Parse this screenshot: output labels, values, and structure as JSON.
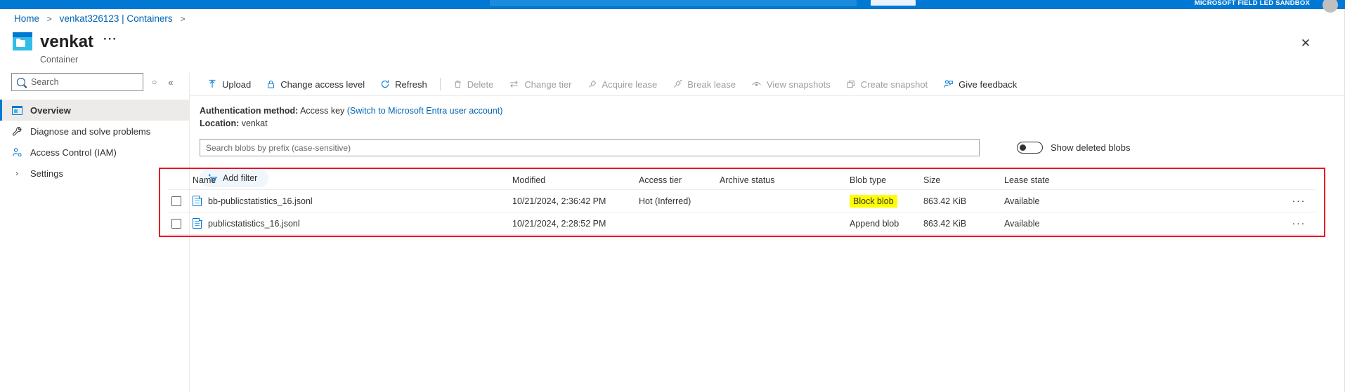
{
  "topbar": {
    "tenant_label": "MICROSOFT FIELD LED SANDBOX",
    "search_placeholder": "",
    "accent_color": "#0078d4"
  },
  "breadcrumb": {
    "items": [
      {
        "label": "Home"
      },
      {
        "label": "venkat326123 | Containers"
      }
    ],
    "separator": ">"
  },
  "header": {
    "title": "venkat",
    "subtitle": "Container",
    "ellipsis": "···",
    "close_label": "✕"
  },
  "sidebar": {
    "search_placeholder": "Search",
    "refresh_glyph": "○",
    "collapse_glyph": "«",
    "items": [
      {
        "label": "Overview",
        "icon": "overview-icon",
        "selected": true
      },
      {
        "label": "Diagnose and solve problems",
        "icon": "wrench-icon",
        "selected": false
      },
      {
        "label": "Access Control (IAM)",
        "icon": "person-key-icon",
        "selected": false
      },
      {
        "label": "Settings",
        "icon": "chevron-right-icon",
        "selected": false
      }
    ]
  },
  "toolbar": {
    "commands": [
      {
        "label": "Upload",
        "icon": "upload-icon",
        "disabled": false
      },
      {
        "label": "Change access level",
        "icon": "lock-icon",
        "disabled": false
      },
      {
        "label": "Refresh",
        "icon": "refresh-icon",
        "disabled": false
      },
      {
        "separator": true
      },
      {
        "label": "Delete",
        "icon": "trash-icon",
        "disabled": true
      },
      {
        "label": "Change tier",
        "icon": "swap-icon",
        "disabled": true
      },
      {
        "label": "Acquire lease",
        "icon": "plug-icon",
        "disabled": true
      },
      {
        "label": "Break lease",
        "icon": "unplug-icon",
        "disabled": true
      },
      {
        "label": "View snapshots",
        "icon": "eye-icon",
        "disabled": true
      },
      {
        "label": "Create snapshot",
        "icon": "copy-icon",
        "disabled": true
      },
      {
        "label": "Give feedback",
        "icon": "feedback-icon",
        "disabled": false
      }
    ]
  },
  "info": {
    "auth_label": "Authentication method:",
    "auth_value": "Access key",
    "auth_link": "(Switch to Microsoft Entra user account)",
    "location_label": "Location:",
    "location_value": "venkat"
  },
  "filters": {
    "prefix_search_placeholder": "Search blobs by prefix (case-sensitive)",
    "prefix_search_value": "",
    "show_deleted_label": "Show deleted blobs",
    "show_deleted_on": false,
    "add_filter_label": "Add filter"
  },
  "table": {
    "highlight_border_color": "#e81123",
    "columns": [
      "Name",
      "Modified",
      "Access tier",
      "Archive status",
      "Blob type",
      "Size",
      "Lease state"
    ],
    "rows": [
      {
        "checked": false,
        "name": "bb-publicstatistics_16.jsonl",
        "modified": "10/21/2024, 2:36:42 PM",
        "access_tier": "Hot (Inferred)",
        "archive_status": "",
        "blob_type": "Block blob",
        "blob_type_highlighted": true,
        "size": "863.42 KiB",
        "lease_state": "Available",
        "menu": "···"
      },
      {
        "checked": false,
        "name": "publicstatistics_16.jsonl",
        "modified": "10/21/2024, 2:28:52 PM",
        "access_tier": "",
        "archive_status": "",
        "blob_type": "Append blob",
        "blob_type_highlighted": false,
        "size": "863.42 KiB",
        "lease_state": "Available",
        "menu": "···"
      }
    ]
  }
}
